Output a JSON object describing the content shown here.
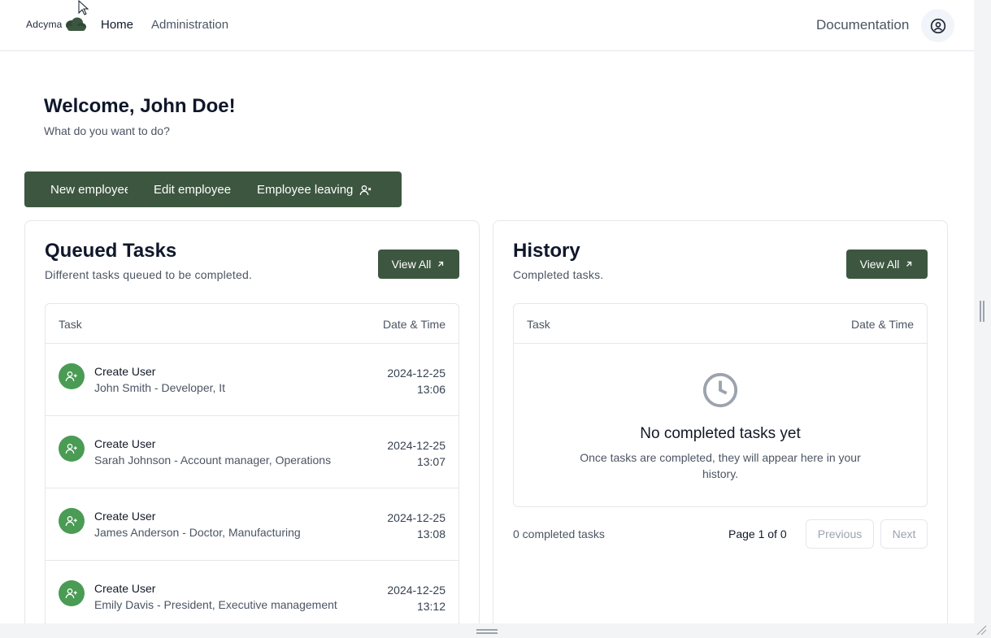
{
  "nav": {
    "logo_text": "Adcyma",
    "home": "Home",
    "administration": "Administration",
    "documentation": "Documentation"
  },
  "welcome": {
    "title": "Welcome, John Doe!",
    "subtitle": "What do you want to do?"
  },
  "actions": {
    "new_employee": "New employee",
    "edit_employee": "Edit employee",
    "employee_leaving": "Employee leaving"
  },
  "queued": {
    "title": "Queued Tasks",
    "subtitle": "Different tasks queued to be completed.",
    "view_all": "View All",
    "col_task": "Task",
    "col_date": "Date & Time",
    "rows": [
      {
        "title": "Create User",
        "desc": "John Smith - Developer, It",
        "date": "2024-12-25",
        "time": "13:06"
      },
      {
        "title": "Create User",
        "desc": "Sarah Johnson - Account manager, Operations",
        "date": "2024-12-25",
        "time": "13:07"
      },
      {
        "title": "Create User",
        "desc": "James Anderson - Doctor, Manufacturing",
        "date": "2024-12-25",
        "time": "13:08"
      },
      {
        "title": "Create User",
        "desc": "Emily Davis - President, Executive management",
        "date": "2024-12-25",
        "time": "13:12"
      }
    ]
  },
  "history": {
    "title": "History",
    "subtitle": "Completed tasks.",
    "view_all": "View All",
    "col_task": "Task",
    "col_date": "Date & Time",
    "empty_title": "No completed tasks yet",
    "empty_text": "Once tasks are completed, they will appear here in your history.",
    "count_text": "0 completed tasks",
    "page_text": "Page 1 of 0",
    "prev": "Previous",
    "next": "Next"
  },
  "colors": {
    "brand_green": "#3d5640",
    "row_icon_green": "#4a9b54"
  },
  "icons": {
    "avatar": "user-circle-icon",
    "leaving": "user-minus-icon",
    "view_all": "arrow-up-right-icon",
    "row": "user-plus-icon",
    "empty": "clock-icon"
  }
}
